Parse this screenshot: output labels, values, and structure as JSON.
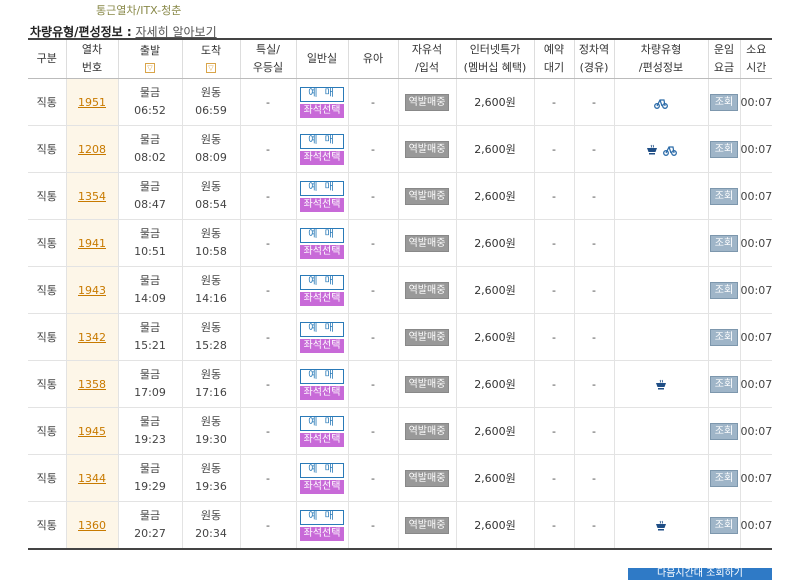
{
  "breadcrumb": {
    "first": "통근열차",
    "sep": "/",
    "second": "ITX-청춘"
  },
  "info": {
    "label": "차량유형/편성정보 :",
    "more": "자세히 알아보기"
  },
  "columns": {
    "type": "구분",
    "train_no": [
      "열차",
      "번호"
    ],
    "depart": "출발",
    "arrive": "도착",
    "special": [
      "특실/",
      "우등실"
    ],
    "general": "일반실",
    "infant": "유아",
    "free_seat": [
      "자유석",
      "/입석"
    ],
    "internet": [
      "인터넷특가",
      "(멤버십 혜택)"
    ],
    "reserve_wait": [
      "예약",
      "대기"
    ],
    "stop": [
      "정차역",
      "(경유)"
    ],
    "car_type": [
      "차량유형",
      "/편성정보"
    ],
    "fare": [
      "운임",
      "요금"
    ],
    "duration": [
      "소요",
      "시간"
    ]
  },
  "sort_icon": "▽",
  "buttons": {
    "reserve": "예 매",
    "seat": "좌석선택",
    "station": "역발매중",
    "query": "조회"
  },
  "bottom_button": "다음시간대 조회하기",
  "rows": [
    {
      "type": "직통",
      "train_no": "1951",
      "dep_station": "물금",
      "dep_time": "06:52",
      "arr_station": "원동",
      "arr_time": "06:59",
      "special": "-",
      "infant": "-",
      "price": "2,600원",
      "wait": "-",
      "stop": "-",
      "icons": [
        "bicycle-icon"
      ],
      "duration": "00:07"
    },
    {
      "type": "직통",
      "train_no": "1208",
      "dep_station": "물금",
      "dep_time": "08:02",
      "arr_station": "원동",
      "arr_time": "08:09",
      "special": "-",
      "infant": "-",
      "price": "2,600원",
      "wait": "-",
      "stop": "-",
      "icons": [
        "cafe-icon",
        "bicycle-icon"
      ],
      "duration": "00:07"
    },
    {
      "type": "직통",
      "train_no": "1354",
      "dep_station": "물금",
      "dep_time": "08:47",
      "arr_station": "원동",
      "arr_time": "08:54",
      "special": "-",
      "infant": "-",
      "price": "2,600원",
      "wait": "-",
      "stop": "-",
      "icons": [],
      "duration": "00:07"
    },
    {
      "type": "직통",
      "train_no": "1941",
      "dep_station": "물금",
      "dep_time": "10:51",
      "arr_station": "원동",
      "arr_time": "10:58",
      "special": "-",
      "infant": "-",
      "price": "2,600원",
      "wait": "-",
      "stop": "-",
      "icons": [],
      "duration": "00:07"
    },
    {
      "type": "직통",
      "train_no": "1943",
      "dep_station": "물금",
      "dep_time": "14:09",
      "arr_station": "원동",
      "arr_time": "14:16",
      "special": "-",
      "infant": "-",
      "price": "2,600원",
      "wait": "-",
      "stop": "-",
      "icons": [],
      "duration": "00:07"
    },
    {
      "type": "직통",
      "train_no": "1342",
      "dep_station": "물금",
      "dep_time": "15:21",
      "arr_station": "원동",
      "arr_time": "15:28",
      "special": "-",
      "infant": "-",
      "price": "2,600원",
      "wait": "-",
      "stop": "-",
      "icons": [],
      "duration": "00:07"
    },
    {
      "type": "직통",
      "train_no": "1358",
      "dep_station": "물금",
      "dep_time": "17:09",
      "arr_station": "원동",
      "arr_time": "17:16",
      "special": "-",
      "infant": "-",
      "price": "2,600원",
      "wait": "-",
      "stop": "-",
      "icons": [
        "cafe-icon"
      ],
      "duration": "00:07"
    },
    {
      "type": "직통",
      "train_no": "1945",
      "dep_station": "물금",
      "dep_time": "19:23",
      "arr_station": "원동",
      "arr_time": "19:30",
      "special": "-",
      "infant": "-",
      "price": "2,600원",
      "wait": "-",
      "stop": "-",
      "icons": [],
      "duration": "00:07"
    },
    {
      "type": "직통",
      "train_no": "1344",
      "dep_station": "물금",
      "dep_time": "19:29",
      "arr_station": "원동",
      "arr_time": "19:36",
      "special": "-",
      "infant": "-",
      "price": "2,600원",
      "wait": "-",
      "stop": "-",
      "icons": [],
      "duration": "00:07"
    },
    {
      "type": "직통",
      "train_no": "1360",
      "dep_station": "물금",
      "dep_time": "20:27",
      "arr_station": "원동",
      "arr_time": "20:34",
      "special": "-",
      "infant": "-",
      "price": "2,600원",
      "wait": "-",
      "stop": "-",
      "icons": [
        "cafe-icon"
      ],
      "duration": "00:07"
    }
  ]
}
